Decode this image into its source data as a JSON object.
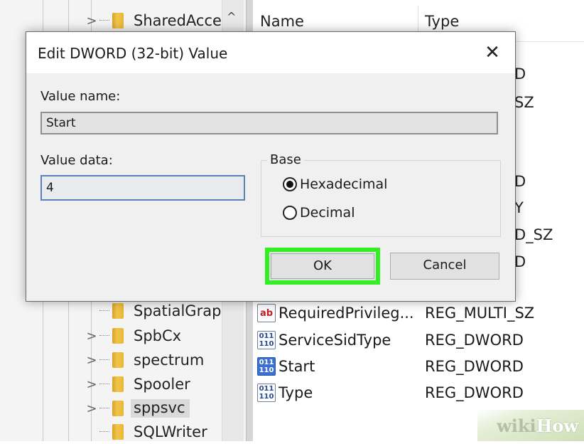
{
  "tree": {
    "items": [
      {
        "label": "SharedAcce",
        "expander": ">",
        "selected": false
      },
      {
        "label": "SpatialGrap",
        "expander": "",
        "selected": false
      },
      {
        "label": "SpbCx",
        "expander": ">",
        "selected": false
      },
      {
        "label": "spectrum",
        "expander": ">",
        "selected": false
      },
      {
        "label": "Spooler",
        "expander": ">",
        "selected": false
      },
      {
        "label": "sppsvc",
        "expander": ">",
        "selected": true
      },
      {
        "label": "SQLWriter",
        "expander": "",
        "selected": false
      }
    ],
    "scroll_up_icon": "^"
  },
  "list": {
    "headers": {
      "name": "Name",
      "type": "Type"
    },
    "partial_types": [
      "D",
      "SZ",
      "D",
      "Y",
      "D_SZ",
      "D"
    ],
    "rows": [
      {
        "name": "RequiredPrivileg...",
        "type": "REG_MULTI_SZ",
        "icon": "ab",
        "icon_kind": "string"
      },
      {
        "name": "ServiceSidType",
        "type": "REG_DWORD",
        "icon": "011 110",
        "icon_kind": "dword"
      },
      {
        "name": "Start",
        "type": "REG_DWORD",
        "icon": "011 110",
        "icon_kind": "dword-selected"
      },
      {
        "name": "Type",
        "type": "REG_DWORD",
        "icon": "011 110",
        "icon_kind": "dword"
      }
    ]
  },
  "dialog": {
    "title": "Edit DWORD (32-bit) Value",
    "close_glyph": "✕",
    "value_name_label": "Value name:",
    "value_name": "Start",
    "value_data_label": "Value data:",
    "value_data": "4",
    "base_label": "Base",
    "base_options": [
      {
        "label": "Hexadecimal",
        "checked": true
      },
      {
        "label": "Decimal",
        "checked": false
      }
    ],
    "ok_label": "OK",
    "cancel_label": "Cancel"
  },
  "highlight_color": "#33ee22",
  "watermark": {
    "wiki": "wiki",
    "how": "How"
  }
}
